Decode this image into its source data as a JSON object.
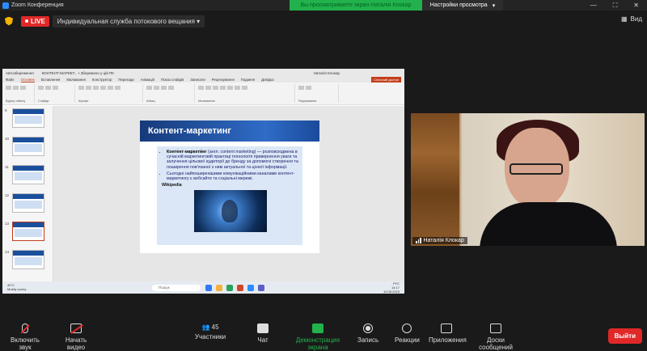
{
  "window": {
    "title": "Zoom Конференция",
    "controls": [
      "—",
      "⛶",
      "✕"
    ]
  },
  "share_banner": {
    "text": "Вы просматриваете экран Наталія Клокар"
  },
  "view_settings": {
    "label": "Настройки просмотра",
    "caret": "▾"
  },
  "topbar": {
    "live_label": "LIVE",
    "stream_name": "Индивидуальная служба потокового вещания",
    "stream_caret": "▾",
    "view_label": "Вид"
  },
  "shared": {
    "pp_titlebar": {
      "autosave": "Автозбереження",
      "doc_title": "КОНТЕНТ-МАРКЕТ... • Збережено у цій ПК",
      "user": "Наталія Клокар"
    },
    "pp_tabs": [
      "Файл",
      "Основне",
      "Вставлення",
      "Малювання",
      "Конструктор",
      "Переходи",
      "Анімація",
      "Показ слайдів",
      "Записати",
      "Рецензування",
      "Подання",
      "Довідка"
    ],
    "coshare_label": "Спільний доступ",
    "ribbon_groups": [
      "Буфер обміну",
      "Слайди",
      "Шрифт",
      "Абзац",
      "Малювання",
      "Редагування"
    ],
    "thumb_numbers": [
      "9",
      "10",
      "11",
      "12",
      "13",
      "14"
    ],
    "slide": {
      "title": "Контент-маркетинг",
      "bullet1_term": "Конте́нт-маркети́нг",
      "bullet1_rest": "(англ. content marketing) — розповсюджена в сучасній маркетинговій практиці технологія привернення уваги та залучення цільової аудиторії до бренду за допомоги створення та поширення пов'язаної з ним актуальної та цінної інформації.",
      "bullet2": "Сьогодні найпоширенішими комунікаційними каналами контент-маркетингу є вебсайти та соціальні мережі.",
      "source": "Wikipedia"
    },
    "notes_placeholder": "Нотатки до слайда",
    "status": {
      "left": "Слайд 13 з 32   українська (Україна)   Спеціальні можливості: шукать по ліст",
      "zoom": "72%"
    },
    "taskbar": {
      "weather_temp": "40°C",
      "weather_desc": "Mostly sunny",
      "search": "Пошук",
      "lang": "РУС",
      "time": "14:17",
      "date": "10.08.2023"
    }
  },
  "video": {
    "participant_name": "Наталія Клокар"
  },
  "controls": {
    "mute": "Включить звук",
    "video": "Начать видео",
    "participants": "Участники",
    "participants_count": "45",
    "chat": "Чат",
    "share": "Демонстрация экрана",
    "record": "Запись",
    "reactions": "Реакции",
    "apps": "Приложения",
    "whiteboard": "Доски сообщений",
    "leave": "Выйти"
  },
  "colors": {
    "accent": "#2d8cff",
    "live": "#e02828",
    "banner": "#22b14c",
    "pp_brand": "#c43e1c"
  }
}
